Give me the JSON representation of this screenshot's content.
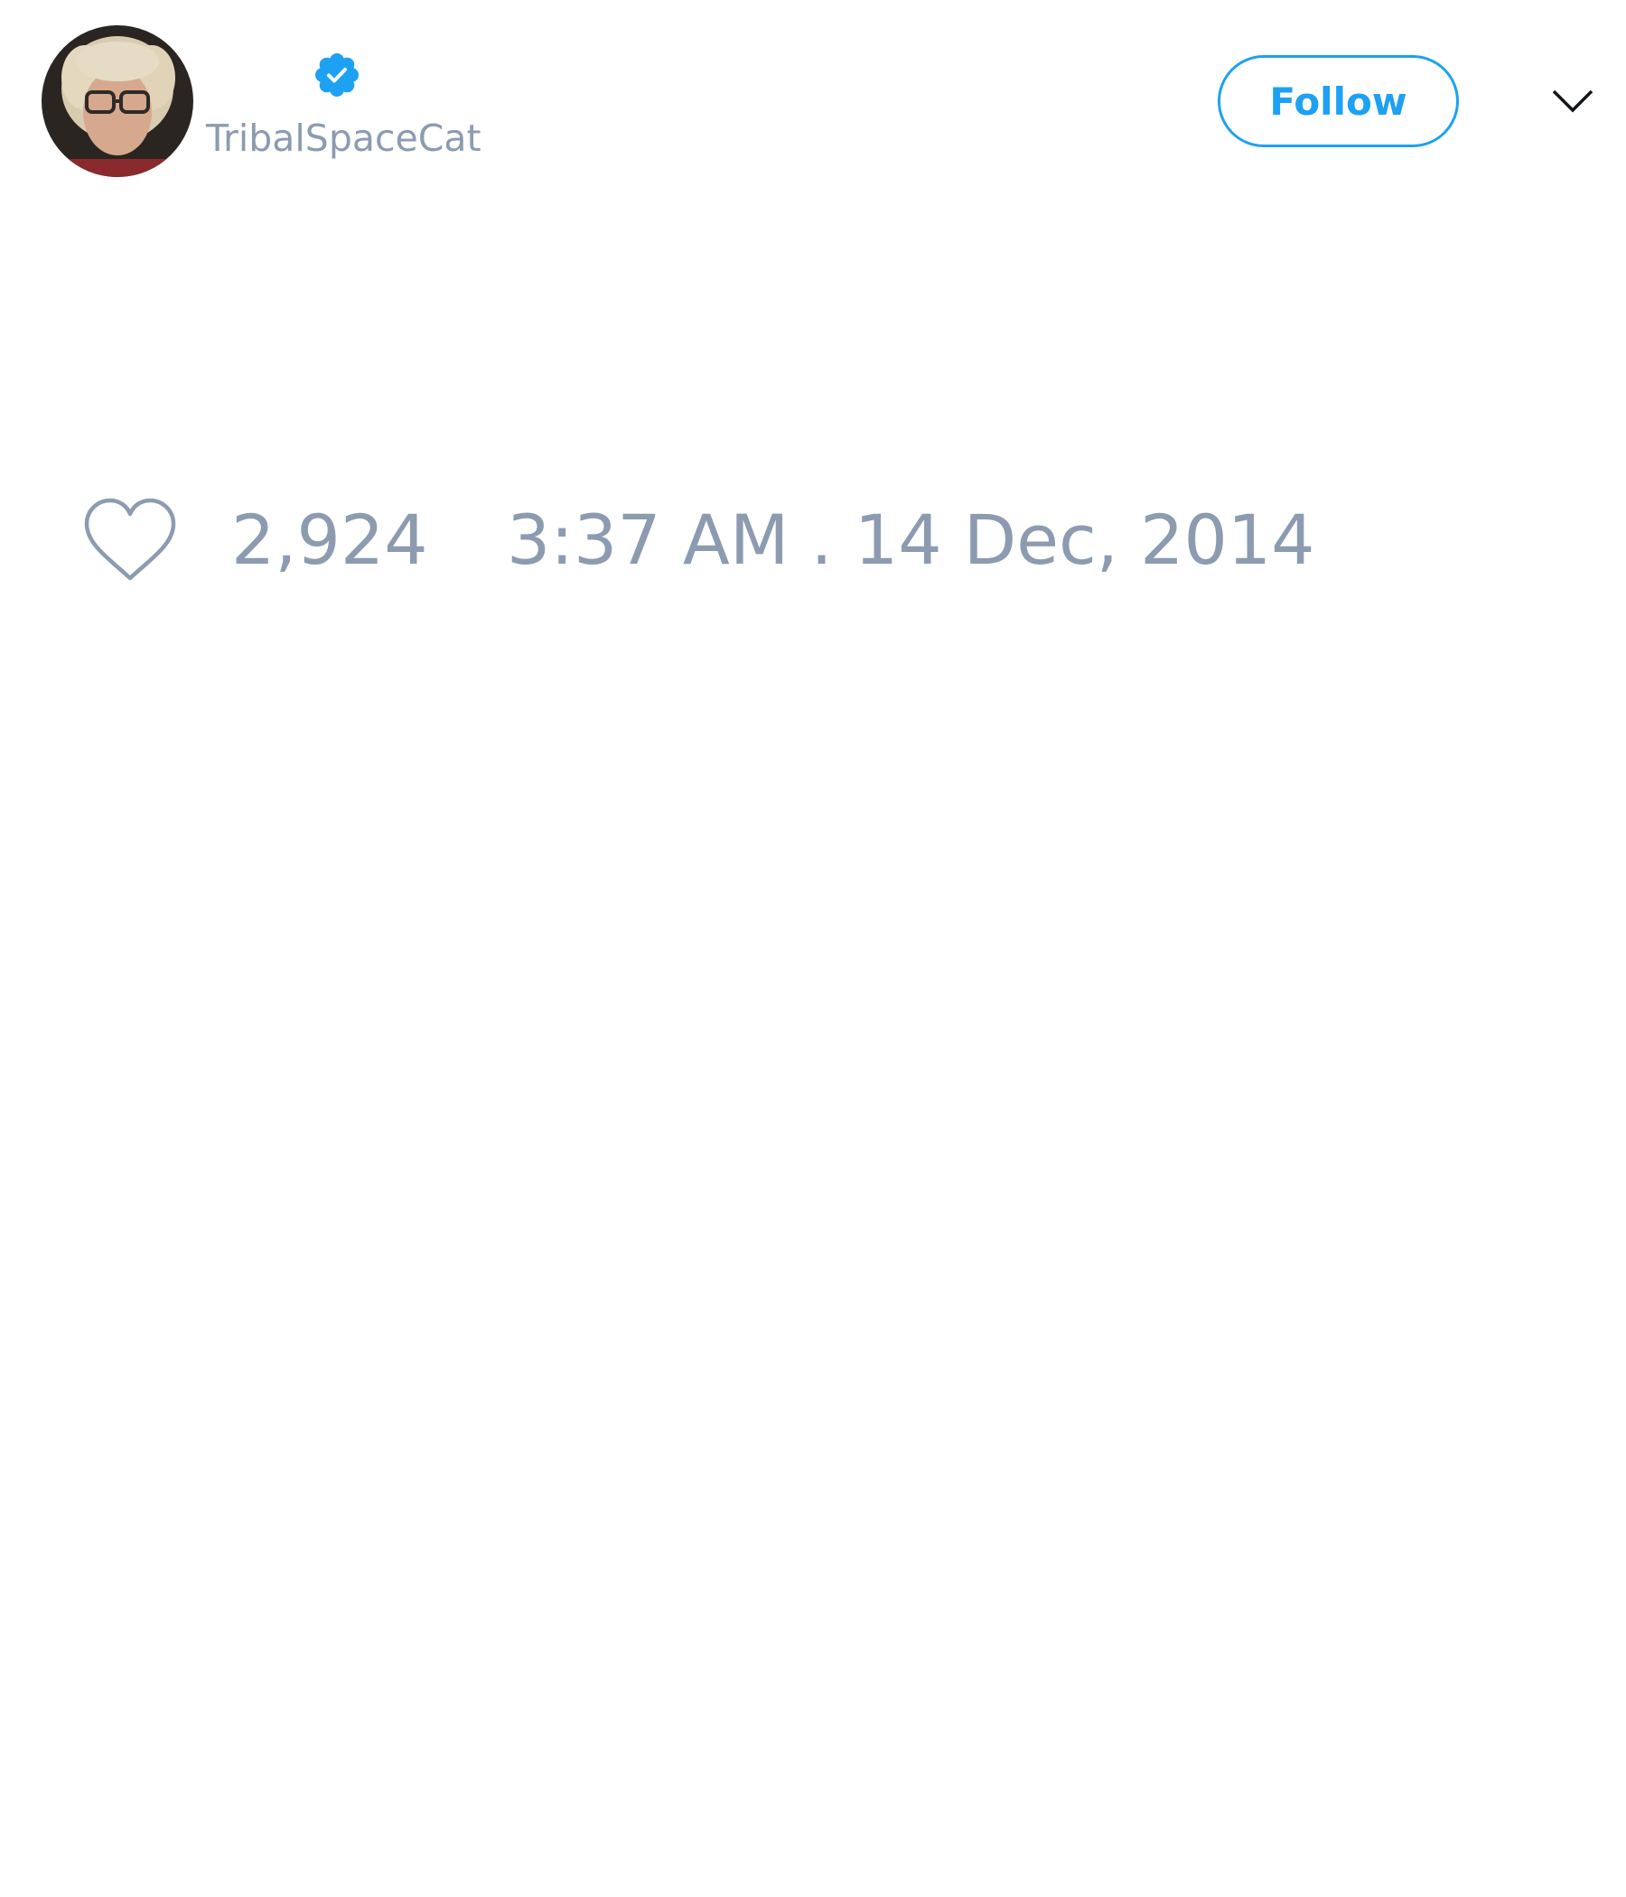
{
  "tweet": {
    "author": {
      "handle": "TribalSpaceCat",
      "verified": true,
      "avatar_icon": "user-avatar-photo"
    },
    "follow_label": "Follow",
    "menu_icon": "chevron-down-icon",
    "likes": {
      "icon": "heart-icon",
      "count": "2,924"
    },
    "timestamp": "3:37 AM . 14 Dec, 2014"
  },
  "colors": {
    "accent": "#1da1f2",
    "muted_text": "#8c9bb0",
    "icon_stroke": "#8c9bb0",
    "caret": "#14171a"
  }
}
